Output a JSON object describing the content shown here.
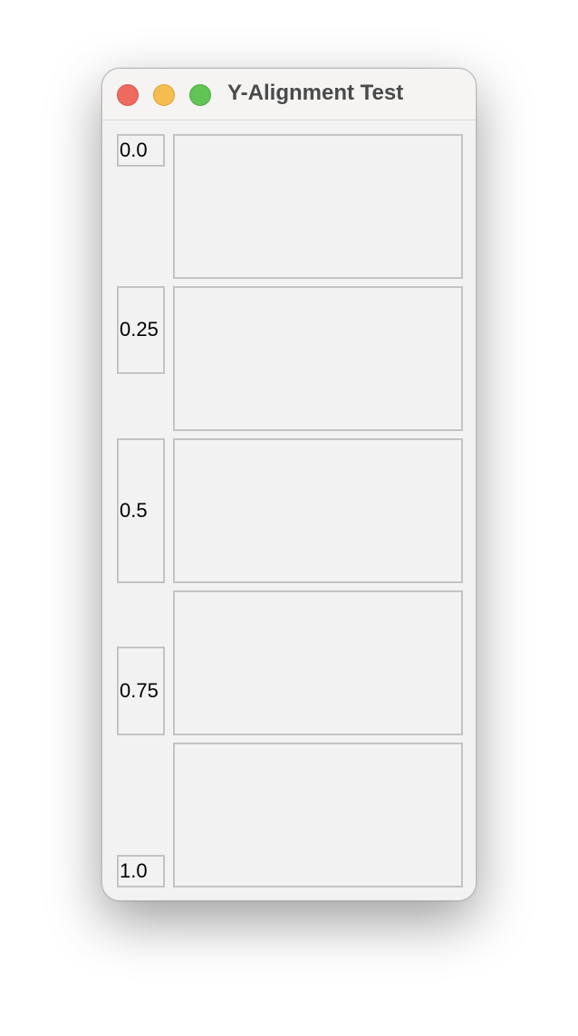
{
  "window": {
    "title": "Y-Alignment Test"
  },
  "rows": [
    {
      "label": "0.0"
    },
    {
      "label": "0.25"
    },
    {
      "label": "0.5"
    },
    {
      "label": "0.75"
    },
    {
      "label": "1.0"
    }
  ],
  "colors": {
    "close": "#ee6a5f",
    "minimize": "#f5bd4f",
    "zoom": "#61c454",
    "border": "#c3c3c3",
    "background": "#f2f2f2"
  }
}
